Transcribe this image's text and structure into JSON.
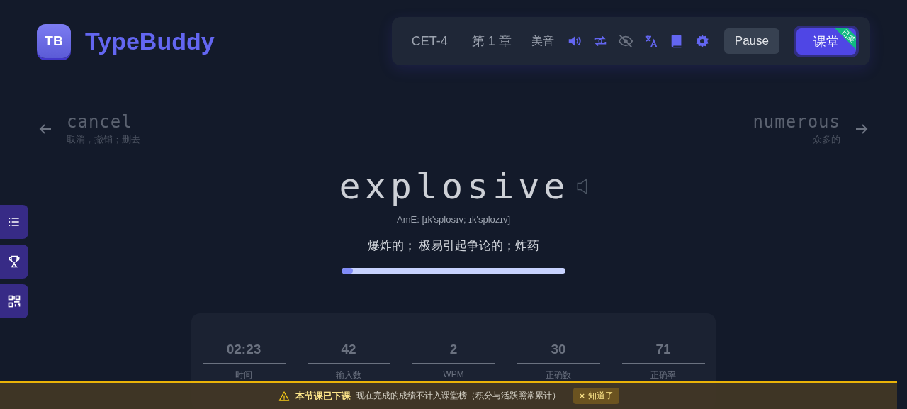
{
  "logo": {
    "badge": "TB",
    "title": "TypeBuddy"
  },
  "toolbar": {
    "dictionary": "CET-4",
    "chapter": "第 1 章",
    "accent": "美音",
    "icons": [
      {
        "kind": "speaker",
        "on": true
      },
      {
        "kind": "repeat",
        "on": true
      },
      {
        "kind": "eye",
        "on": false
      },
      {
        "kind": "translate",
        "on": true
      },
      {
        "kind": "book",
        "on": true
      },
      {
        "kind": "gear",
        "on": true
      }
    ],
    "pause": "Pause",
    "classroom": "课堂",
    "classroom_badge": "已签"
  },
  "side_buttons": [
    {
      "kind": "list"
    },
    {
      "kind": "trophy"
    },
    {
      "kind": "qr"
    }
  ],
  "prev_word": {
    "word": "cancel",
    "meaning": "取消，撤销；删去"
  },
  "next_word": {
    "word": "numerous",
    "meaning": "众多的"
  },
  "word": {
    "text": "explosive",
    "phonetic": "AmE: [ɪk'splosɪv; ɪk'splozɪv]",
    "meaning": "爆炸的；  极易引起争论的；炸药",
    "level": 0.05
  },
  "stats": [
    {
      "value": "02:23",
      "label": "时间"
    },
    {
      "value": "42",
      "label": "输入数"
    },
    {
      "value": "2",
      "label": "WPM"
    },
    {
      "value": "30",
      "label": "正确数"
    },
    {
      "value": "71",
      "label": "正确率"
    }
  ],
  "banner": {
    "title": "本节课已下课",
    "message": "现在完成的成绩不计入课堂榜（积分与活跃照常累计）",
    "dismiss": "知道了"
  }
}
